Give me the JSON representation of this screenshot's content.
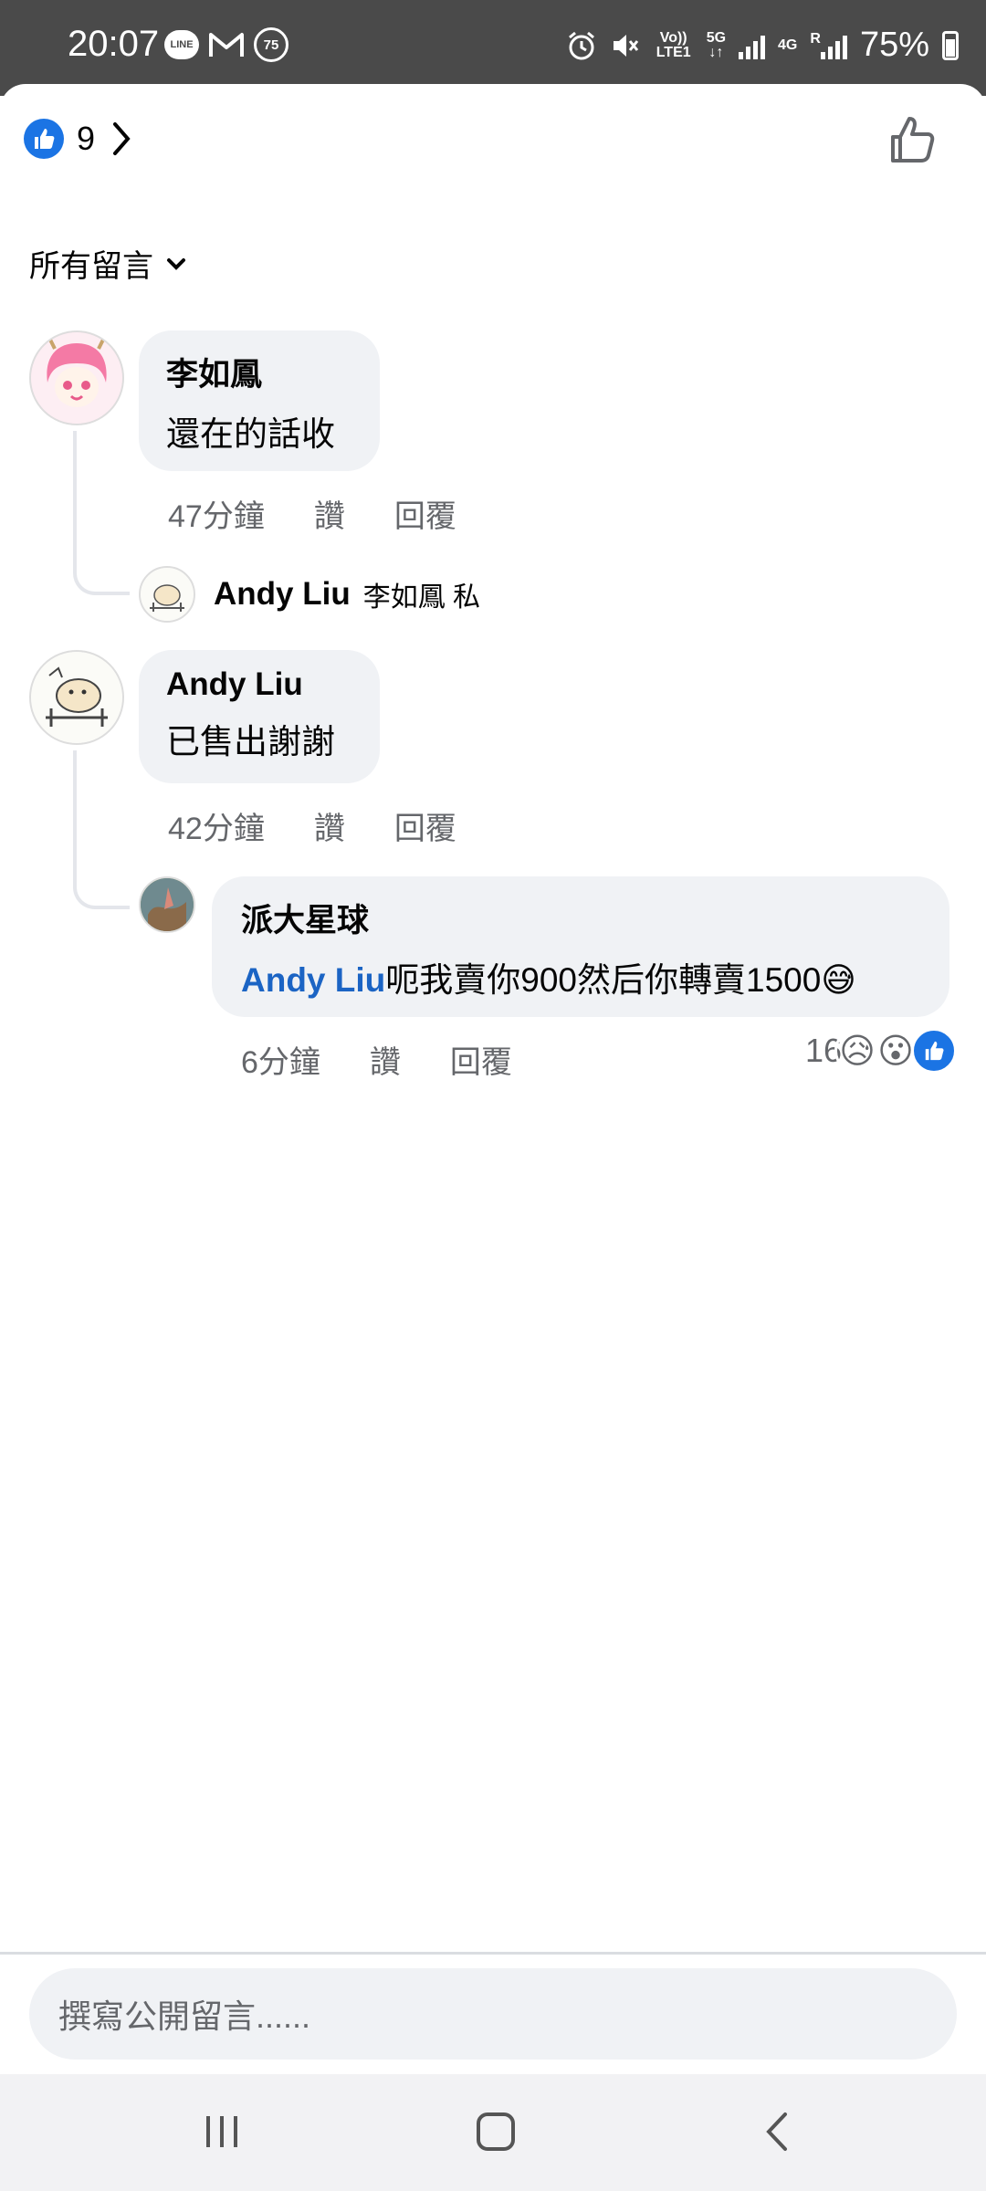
{
  "status_bar": {
    "time": "20:07",
    "left_icons": [
      "line-icon",
      "gmail-icon",
      "notification-count-icon"
    ],
    "notification_count": "75",
    "line_label": "LINE",
    "network_volte": "Vo)) LTE1",
    "network_5g": "5G",
    "network_4g": "4G",
    "roaming": "R",
    "battery_percent": "75%"
  },
  "header": {
    "likes_count": "9"
  },
  "sort": {
    "label": "所有留言"
  },
  "comments": [
    {
      "author": "李如鳳",
      "text": "還在的話收",
      "time": "47分鐘",
      "like_label": "讚",
      "reply_label": "回覆",
      "reply_preview": {
        "author": "Andy Liu",
        "snippet": "李如鳳 私"
      }
    },
    {
      "author": "Andy Liu",
      "text": "已售出謝謝",
      "time": "42分鐘",
      "like_label": "讚",
      "reply_label": "回覆",
      "reply": {
        "author": "派大星球",
        "mention": "Andy Liu",
        "text": "呃我賣你900然后你轉賣1500😅",
        "time": "6分鐘",
        "like_label": "讚",
        "reply_label": "回覆",
        "reaction_count": "16",
        "reactions": [
          "😥",
          "😮",
          "like-icon"
        ]
      }
    }
  ],
  "composer": {
    "placeholder": "撰寫公開留言......"
  },
  "colors": {
    "status_bar": "#4a4a4a",
    "bubble": "#f0f2f5",
    "link": "#1b64c4",
    "like_blue": "#1b74e4"
  }
}
